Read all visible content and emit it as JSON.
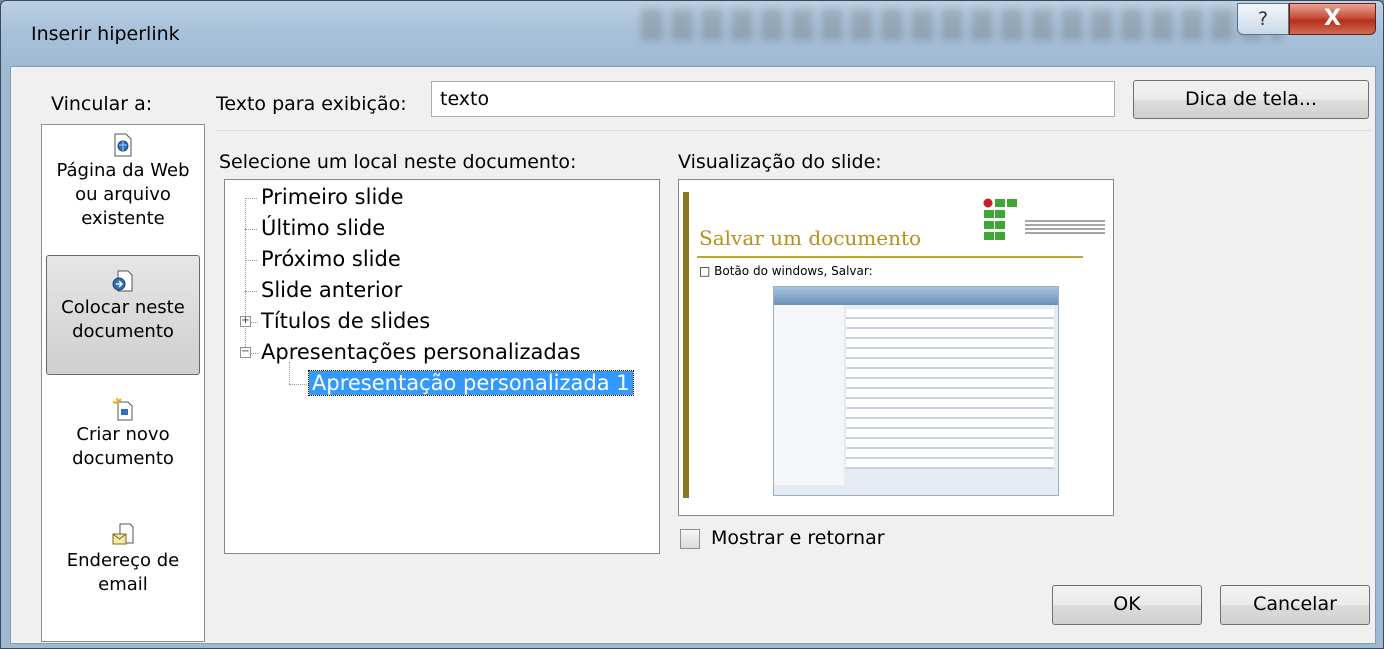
{
  "window": {
    "title": "Inserir hiperlink",
    "help_glyph": "?",
    "close_glyph": "X"
  },
  "link_to": {
    "label": "Vincular a:",
    "items": [
      {
        "label_line1": "Página da Web",
        "label_line2": "ou arquivo",
        "label_line3": "existente",
        "icon": "web-page-icon"
      },
      {
        "label_line1": "Colocar neste",
        "label_line2": "documento",
        "icon": "place-in-document-icon",
        "selected": true
      },
      {
        "label_line1": "Criar novo",
        "label_line2": "documento",
        "icon": "new-document-icon"
      },
      {
        "label_line1": "Endereço de",
        "label_line2": "email",
        "icon": "email-icon"
      }
    ]
  },
  "display_text": {
    "label": "Texto para exibição:",
    "value": "texto"
  },
  "screentip_button": "Dica de tela...",
  "location": {
    "label": "Selecione um local neste documento:",
    "tree": {
      "first": "Primeiro slide",
      "last": "Último slide",
      "next": "Próximo slide",
      "previous": "Slide anterior",
      "titles": "Títulos de slides",
      "custom_shows": "Apresentações personalizadas",
      "custom_show_1": "Apresentação personalizada 1"
    }
  },
  "preview": {
    "label": "Visualização do slide:",
    "slide_title": "Salvar um documento",
    "slide_bullet": "Botão do windows, Salvar:"
  },
  "show_and_return": {
    "label": "Mostrar e retornar",
    "checked": false
  },
  "buttons": {
    "ok": "OK",
    "cancel": "Cancelar"
  }
}
